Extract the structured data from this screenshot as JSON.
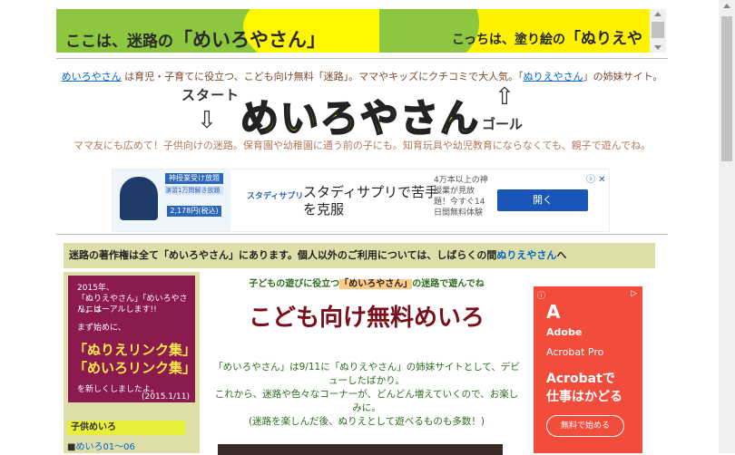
{
  "banner": {
    "left_prefix": "ここは、迷路の",
    "left_name": "「めいろやさん」",
    "right_prefix": "こっちは、塗り絵の",
    "right_name": "「ぬりえやさん」"
  },
  "intro": {
    "link1": "めいろやさん",
    "text1": " は育児・子育てに役立つ、こども向け無料「迷路」。ママやキッズにクチコミで大人気。「",
    "link2": "ぬりえやさん",
    "text2": "」の姉妹サイト。"
  },
  "logo": {
    "start": "スタート",
    "arrow_down": "⇩",
    "title": "めいろやさん",
    "arrow_up": "⇧",
    "goal": "ゴール"
  },
  "tagline": "ママ友にも広めて！子供向けの迷路。保育園や幼稚園に通う前の子にも。知育玩具や幼児教育にならなくても、親子で遊んでね。",
  "ad1": {
    "badge1": "神授業受け放題",
    "badge2": "演習1万問解き放題",
    "price": "2,178円(税込)",
    "logo_text": "スタディサプリ",
    "headline_1": "スタディサプリで苦手",
    "headline_2": "を克服",
    "desc": "4万本以上の神授業が見放題！今すぐ14日間無料体験",
    "button": "開く",
    "info": "ⓘ ✕"
  },
  "notice": {
    "text": "迷路の著作権は全て「めいろやさん」にあります。個人以外のご利用については、しばらくの間",
    "link": "ぬりえやさん",
    "suffix": "へ"
  },
  "promo": {
    "line1": "2015年、",
    "line2": "「ぬりえやさん」「めいろやさん」は",
    "line3": "リニューアルします!!",
    "line4": "まず始めに、",
    "line5": "",
    "link1": "「ぬりえリンク集」",
    "link2": "「めいろリンク集」",
    "line6": "を新しくしましたよ。",
    "date": "(2015.1/11)"
  },
  "sidebar": {
    "heading": "子供めいろ",
    "link1": "めいろ01～06"
  },
  "center": {
    "sub_pre": "子どもの遊びに役立つ",
    "sub_hl": "「めいろやさん」",
    "sub_post": "の迷路で遊んでね",
    "title": "こども向け無料めいろ",
    "body1": "「めいろやさん」は9/11に「ぬりえやさん」の姉妹サイトとして、デビューしたばかり。",
    "body2": "これから、迷路や色々なコーナーが、どんどん増えていくので、お楽しみに。",
    "body3": "(迷路を楽しんだ後、ぬりえとして遊べるものも多数！)"
  },
  "ad2": {
    "info": "ⓘ",
    "tri": "▷",
    "logo": "A",
    "brand": "Adobe",
    "product": "Acrobat Pro",
    "catch1": "Acrobatで",
    "catch2": "仕事はかどる",
    "cta": "無料で始める"
  }
}
